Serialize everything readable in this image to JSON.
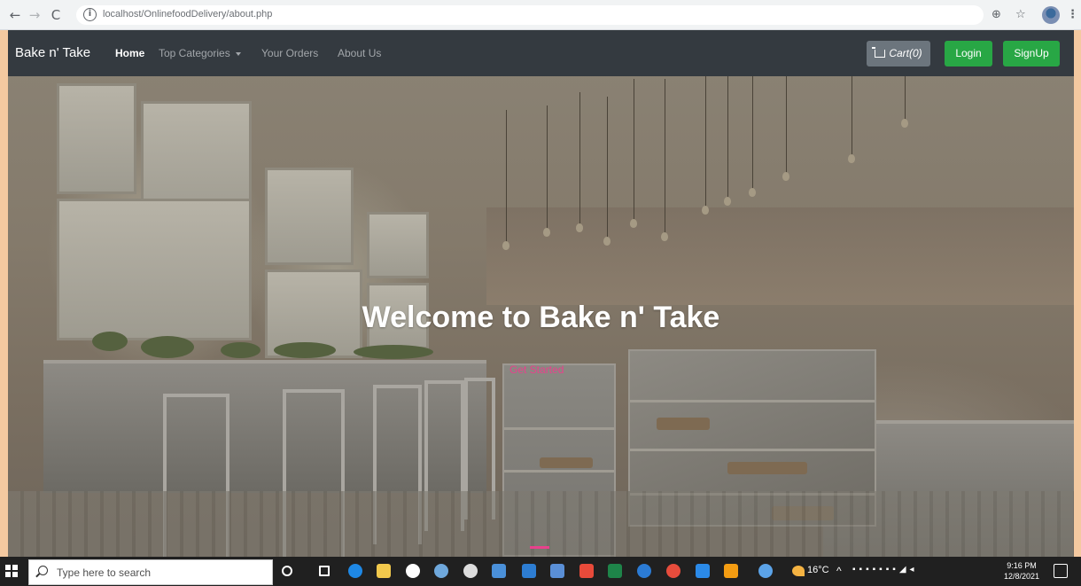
{
  "browser": {
    "url": "localhost/OnlinefoodDelivery/about.php"
  },
  "navbar": {
    "brand": "Bake n' Take",
    "links": [
      "Home",
      "Top Categories",
      "Your Orders",
      "About Us"
    ],
    "cart_label": "Cart(0)",
    "login_label": "Login",
    "signup_label": "SignUp"
  },
  "hero": {
    "title": "Welcome to Bake n' Take",
    "cta": "Get Started"
  },
  "taskbar": {
    "search_placeholder": "Type here to search",
    "weather": "16°C",
    "time": "9:16 PM",
    "date": "12/8/2021"
  },
  "colors": {
    "navbar": "#343a40",
    "success": "#28a745",
    "secondary": "#6c757d",
    "accent": "#e8418c"
  }
}
